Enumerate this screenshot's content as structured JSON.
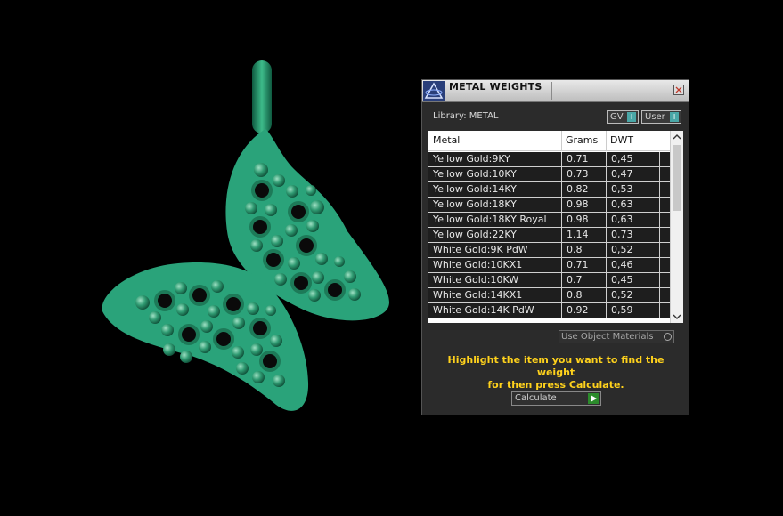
{
  "panel": {
    "title": "METAL WEIGHTS",
    "library_label": "Library: METAL",
    "toggles": [
      {
        "label": "GV",
        "state": "I"
      },
      {
        "label": "User",
        "state": "I"
      }
    ],
    "table": {
      "headers": [
        "Metal",
        "Grams",
        "DWT"
      ],
      "rows": [
        {
          "metal": "Yellow Gold:9KY",
          "grams": "0.71",
          "dwt": "0,45"
        },
        {
          "metal": "Yellow Gold:10KY",
          "grams": "0.73",
          "dwt": "0,47"
        },
        {
          "metal": "Yellow Gold:14KY",
          "grams": "0.82",
          "dwt": "0,53"
        },
        {
          "metal": "Yellow Gold:18KY",
          "grams": "0.98",
          "dwt": "0,63"
        },
        {
          "metal": "Yellow Gold:18KY Royal",
          "grams": "0.98",
          "dwt": "0,63"
        },
        {
          "metal": "Yellow Gold:22KY",
          "grams": "1.14",
          "dwt": "0,73"
        },
        {
          "metal": "White Gold:9K PdW",
          "grams": "0.8",
          "dwt": "0,52"
        },
        {
          "metal": "White Gold:10KX1",
          "grams": "0.71",
          "dwt": "0,46"
        },
        {
          "metal": "White Gold:10KW",
          "grams": "0.7",
          "dwt": "0,45"
        },
        {
          "metal": "White Gold:14KX1",
          "grams": "0.8",
          "dwt": "0,52"
        },
        {
          "metal": "White Gold:14K PdW",
          "grams": "0.92",
          "dwt": "0,59"
        }
      ]
    },
    "use_object_materials": "Use Object Materials",
    "instructions_line1": "Highlight the item you want to find the weight",
    "instructions_line2": "for then press Calculate.",
    "calculate_label": "Calculate",
    "colors": {
      "instruction_text": "#ffd21c",
      "toggle_accent": "#4aa7a7",
      "go_button": "#2b8b2b",
      "model_green": "#2aa37a"
    }
  }
}
